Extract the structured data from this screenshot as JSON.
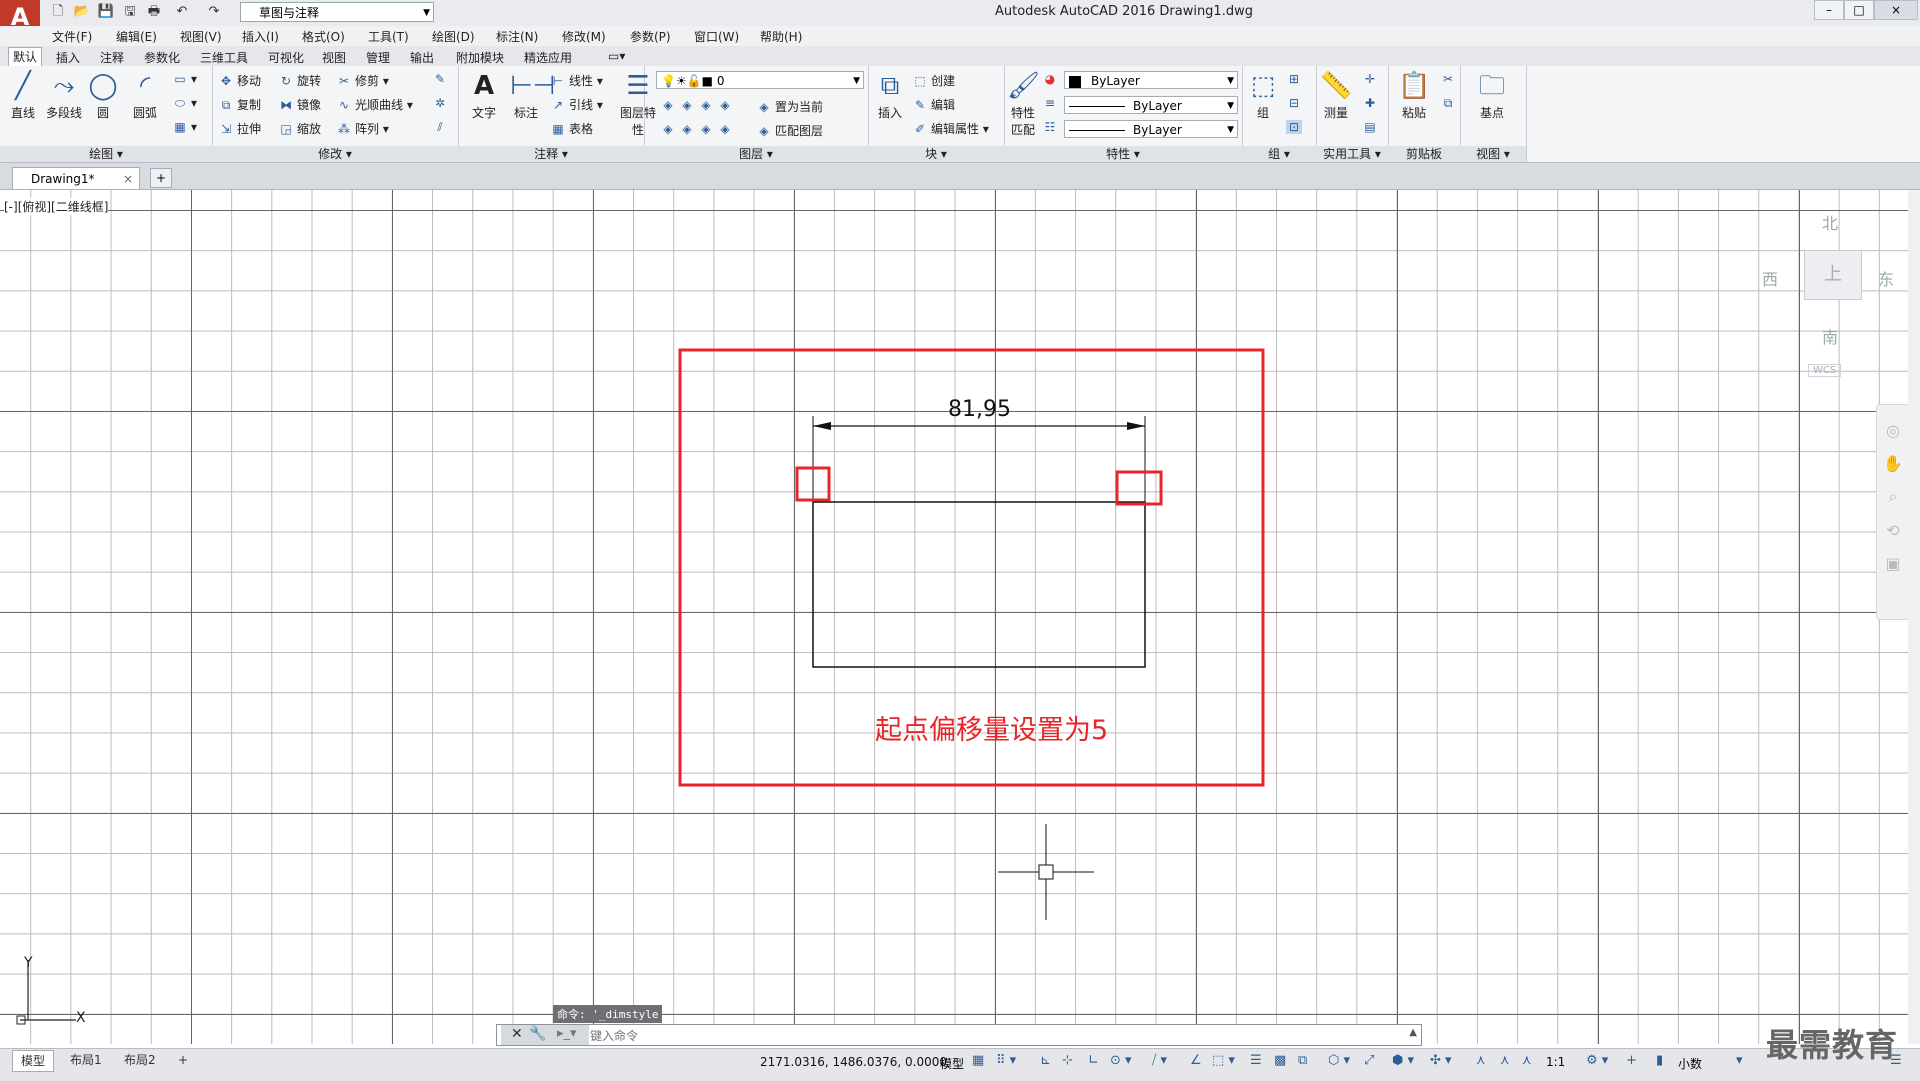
{
  "app": {
    "logo_letter": "A",
    "window_title": "Autodesk AutoCAD 2016    Drawing1.dwg",
    "workspace": "草图与注释",
    "window_controls": [
      "–",
      "□",
      "×"
    ]
  },
  "menubar": [
    "文件(F)",
    "编辑(E)",
    "视图(V)",
    "插入(I)",
    "格式(O)",
    "工具(T)",
    "绘图(D)",
    "标注(N)",
    "修改(M)",
    "参数(P)",
    "窗口(W)",
    "帮助(H)"
  ],
  "ribbon_tabs": [
    "默认",
    "插入",
    "注释",
    "参数化",
    "三维工具",
    "可视化",
    "视图",
    "管理",
    "输出",
    "附加模块",
    "精选应用"
  ],
  "ribbon": {
    "draw": {
      "title": "绘图",
      "big": [
        "直线",
        "多段线",
        "圆",
        "圆弧"
      ]
    },
    "modify": {
      "title": "修改",
      "items": [
        "移动",
        "旋转",
        "修剪",
        "复制",
        "镜像",
        "光顺曲线",
        "拉伸",
        "缩放",
        "阵列"
      ]
    },
    "annotation": {
      "title": "注释",
      "big": [
        "文字",
        "标注"
      ],
      "items": [
        "线性",
        "引线",
        "表格"
      ]
    },
    "layers": {
      "title": "图层",
      "big": "图层特性",
      "layer_name": "0",
      "items": [
        "置为当前",
        "匹配图层"
      ]
    },
    "block": {
      "title": "块",
      "big": "插入",
      "items": [
        "创建",
        "编辑",
        "编辑属性"
      ]
    },
    "properties": {
      "title": "特性",
      "big": "特性匹配",
      "color": "ByLayer",
      "linetype": "ByLayer",
      "lineweight": "ByLayer"
    },
    "groups": {
      "title": "组",
      "big": "组"
    },
    "utilities": {
      "title": "实用工具",
      "big": "测量"
    },
    "clipboard": {
      "title": "剪贴板",
      "big": "粘贴"
    },
    "view": {
      "title": "视图",
      "big": "基点"
    }
  },
  "doc_tab": "Drawing1*",
  "viewport_label": "[-][俯视][二维线框]",
  "viewcube": {
    "north": "北",
    "south": "南",
    "east": "东",
    "west": "西",
    "top": "上",
    "wcs": "WCS"
  },
  "drawing": {
    "dimension_text": "81,95",
    "annotation_text": "起点偏移量设置为5"
  },
  "ucs": {
    "x": "X",
    "y": "Y"
  },
  "command": {
    "history": "命令: '_dimstyle",
    "placeholder": "键入命令"
  },
  "layout_tabs": [
    "模型",
    "布局1",
    "布局2"
  ],
  "status": {
    "coords": "2171.0316, 1486.0376, 0.0000",
    "model": "模型",
    "scale": "1:1",
    "units": "小数"
  },
  "watermark": "最需教育"
}
